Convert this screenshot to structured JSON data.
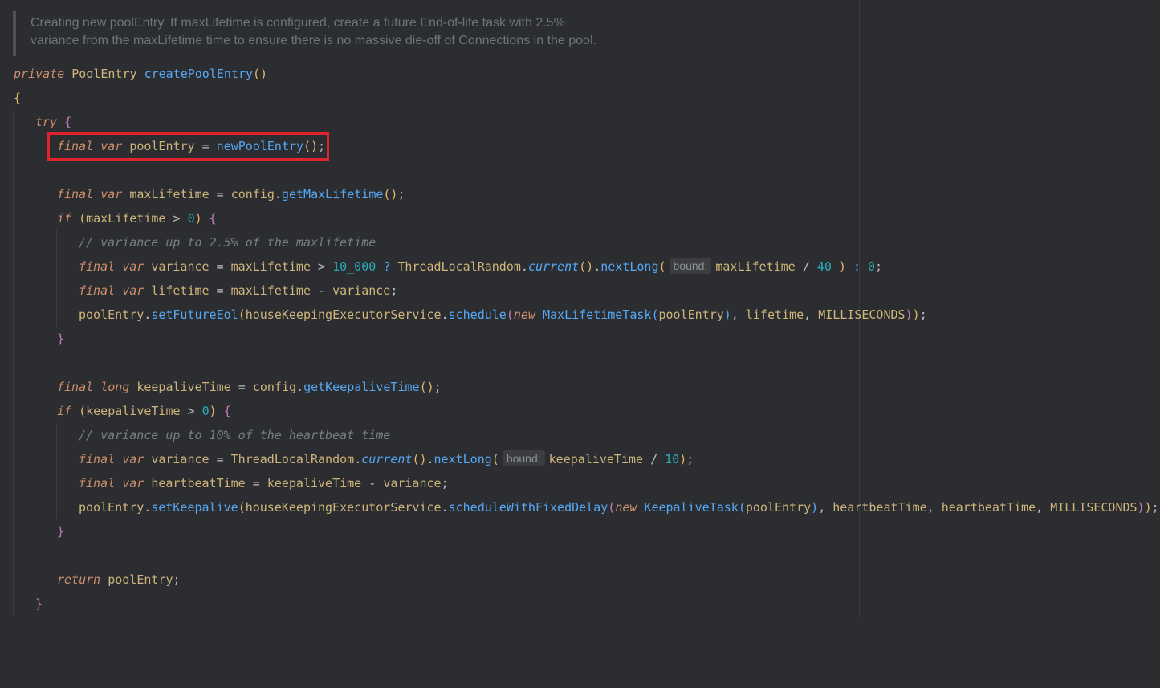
{
  "doc_comment": {
    "line1": "Creating new poolEntry. If maxLifetime is configured, create a future End-of-life task with 2.5%",
    "line2": "variance from the maxLifetime time to ensure there is no massive die-off of Connections in the pool."
  },
  "code": {
    "kw_private": "private",
    "kw_try": "try",
    "kw_final": "final",
    "kw_var": "var",
    "kw_long": "long",
    "kw_if": "if",
    "kw_new": "new",
    "kw_return": "return",
    "type_pool_entry": "PoolEntry",
    "type_tlr": "ThreadLocalRandom",
    "type_max_lifetime_task": "MaxLifetimeTask",
    "type_keepalive_task": "KeepaliveTask",
    "fn_create_pool_entry": "createPoolEntry",
    "fn_new_pool_entry": "newPoolEntry",
    "fn_get_max_lifetime": "getMaxLifetime",
    "fn_get_keepalive_time": "getKeepaliveTime",
    "fn_current": "current",
    "fn_next_long": "nextLong",
    "fn_set_future_eol": "setFutureEol",
    "fn_schedule": "schedule",
    "fn_set_keepalive": "setKeepalive",
    "fn_schedule_fixed": "scheduleWithFixedDelay",
    "var_pool_entry": "poolEntry",
    "var_max_lifetime": "maxLifetime",
    "var_variance": "variance",
    "var_lifetime": "lifetime",
    "var_keepalive_time": "keepaliveTime",
    "var_heartbeat_time": "heartbeatTime",
    "field_config": "config",
    "field_hkes": "houseKeepingExecutorService",
    "const_ms": "MILLISECONDS",
    "num_zero": "0",
    "num_10000": "10_000",
    "num_40": "40",
    "num_10": "10",
    "comment_1": "// variance up to 2.5% of the maxlifetime",
    "comment_2": "// variance up to 10% of the heartbeat time",
    "hint_bound": "bound:"
  }
}
